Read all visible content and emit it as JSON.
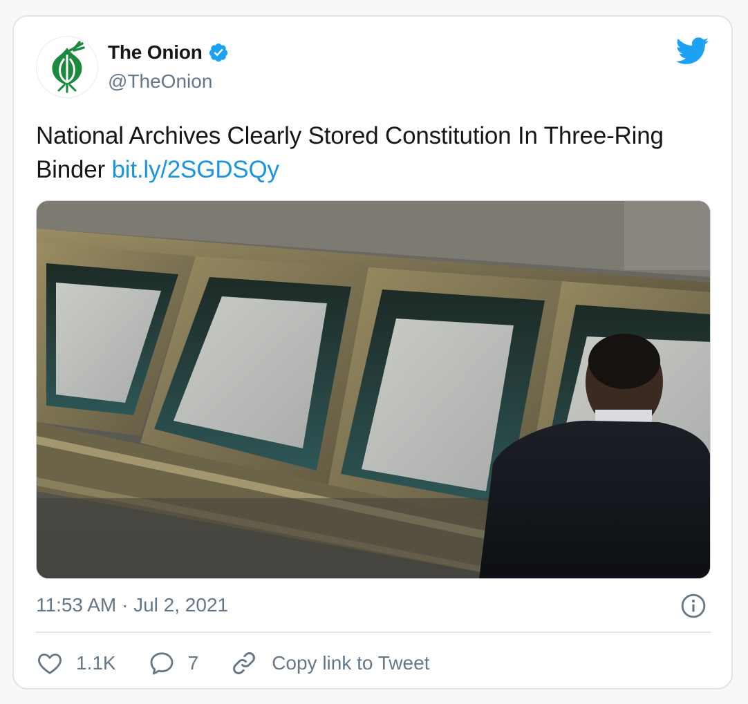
{
  "author": {
    "display_name": "The Onion",
    "handle": "@TheOnion",
    "avatar_icon": "onion-logo-icon",
    "verified_icon": "verified-badge-icon",
    "verified_color": "#1da1f2",
    "brand_color": "#1b8a3e"
  },
  "header": {
    "platform_icon": "twitter-bird-icon",
    "platform_color": "#1da1f2"
  },
  "tweet": {
    "text": "National Archives Clearly Stored Constitution In Three-Ring Binder ",
    "link_text": "bit.ly/2SGDSQy",
    "link_color": "#1b95e0",
    "timestamp": "11:53 AM · Jul 2, 2021"
  },
  "media": {
    "kind": "photo",
    "icon": "photo-icon"
  },
  "actions": {
    "like": {
      "icon": "heart-icon",
      "count": "1.1K"
    },
    "reply": {
      "icon": "reply-bubble-icon",
      "count": "7"
    },
    "copy_link": {
      "icon": "link-icon",
      "label": "Copy link to Tweet"
    },
    "info": {
      "icon": "info-icon"
    }
  }
}
